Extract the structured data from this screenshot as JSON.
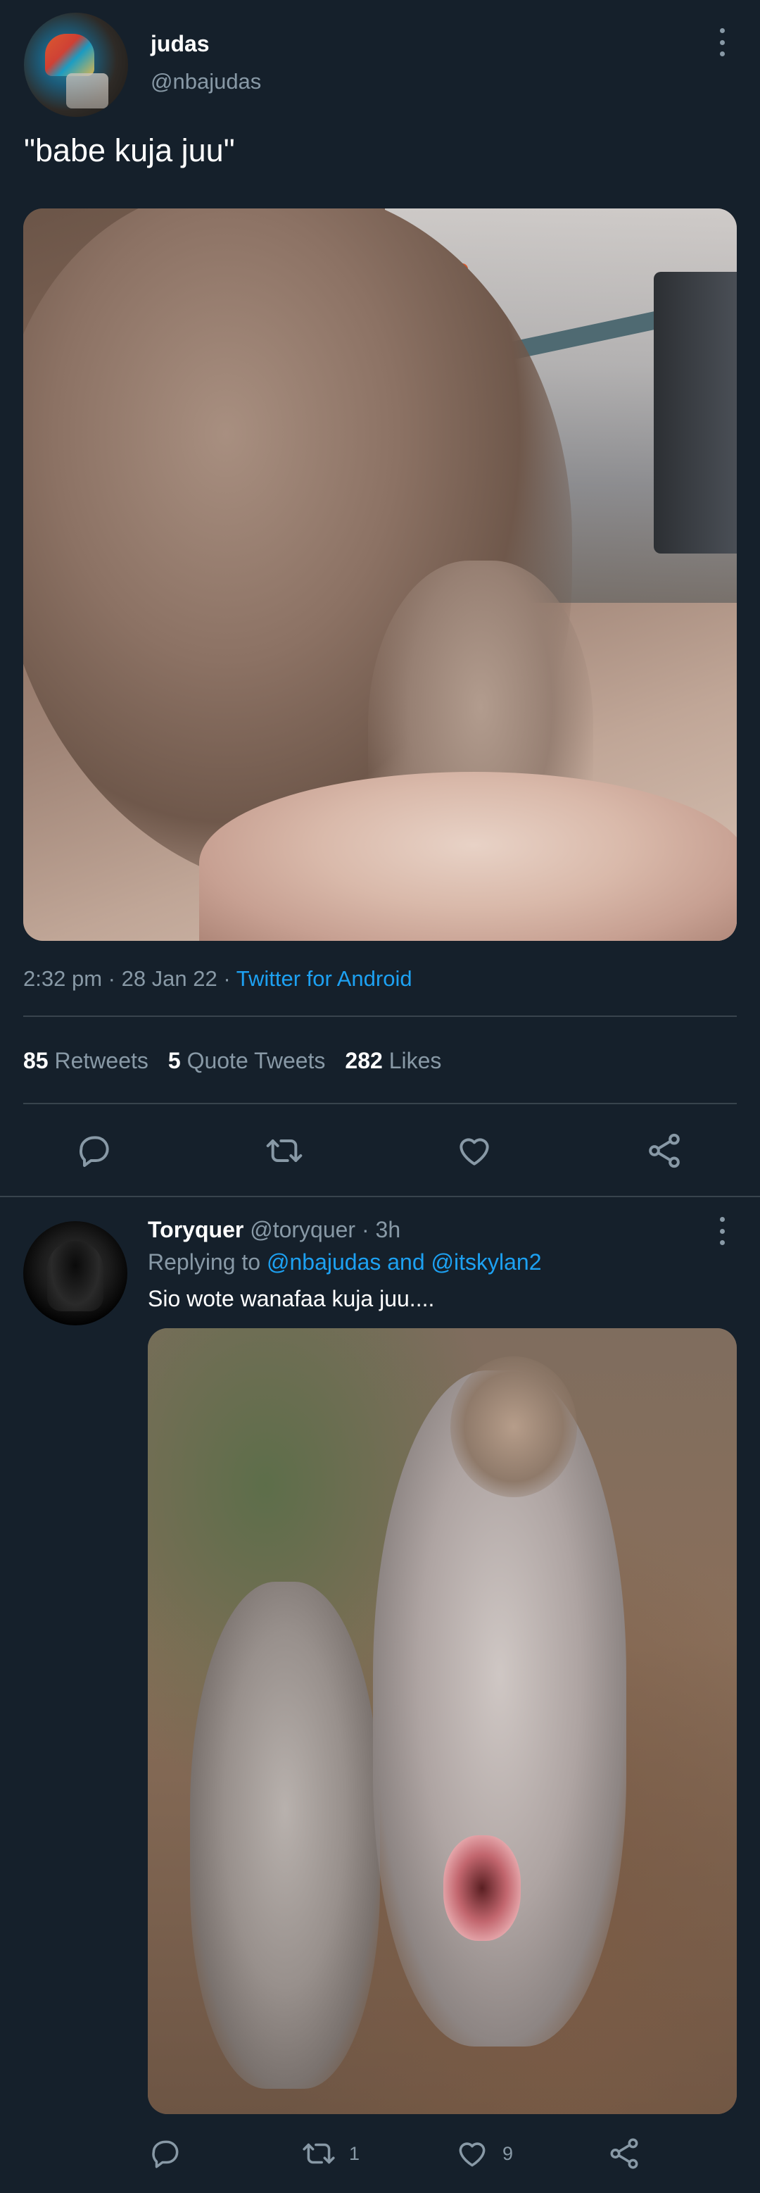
{
  "main_tweet": {
    "author_name": "judas",
    "author_handle": "@nbajudas",
    "text": "\"babe kuja juu\"",
    "media_alt_icon": "raw-chicken-photo",
    "meta": {
      "time": "2:32 pm",
      "separator": " · ",
      "date": "28 Jan 22",
      "source": "Twitter for Android"
    },
    "stats": {
      "retweets_count": "85",
      "retweets_label": "Retweets",
      "quotes_count": "5",
      "quotes_label": "Quote Tweets",
      "likes_count": "282",
      "likes_label": "Likes"
    },
    "actions": [
      "reply-icon",
      "retweet-icon",
      "like-icon",
      "share-icon"
    ]
  },
  "reply": {
    "author_name": "Toryquer",
    "author_handle": "@toryquer",
    "time_ago": "· 3h",
    "replying_prefix": "Replying to",
    "mentions": "@nbajudas and @itskylan2",
    "text": "Sio wote wanafaa kuja juu....",
    "media_alt_icon": "kangaroo-photo",
    "retweet_count": "1",
    "like_count": "9"
  },
  "colors": {
    "background": "#15202b",
    "secondary_text": "#8899a6",
    "link": "#1da1f2",
    "divider": "#38444d"
  }
}
